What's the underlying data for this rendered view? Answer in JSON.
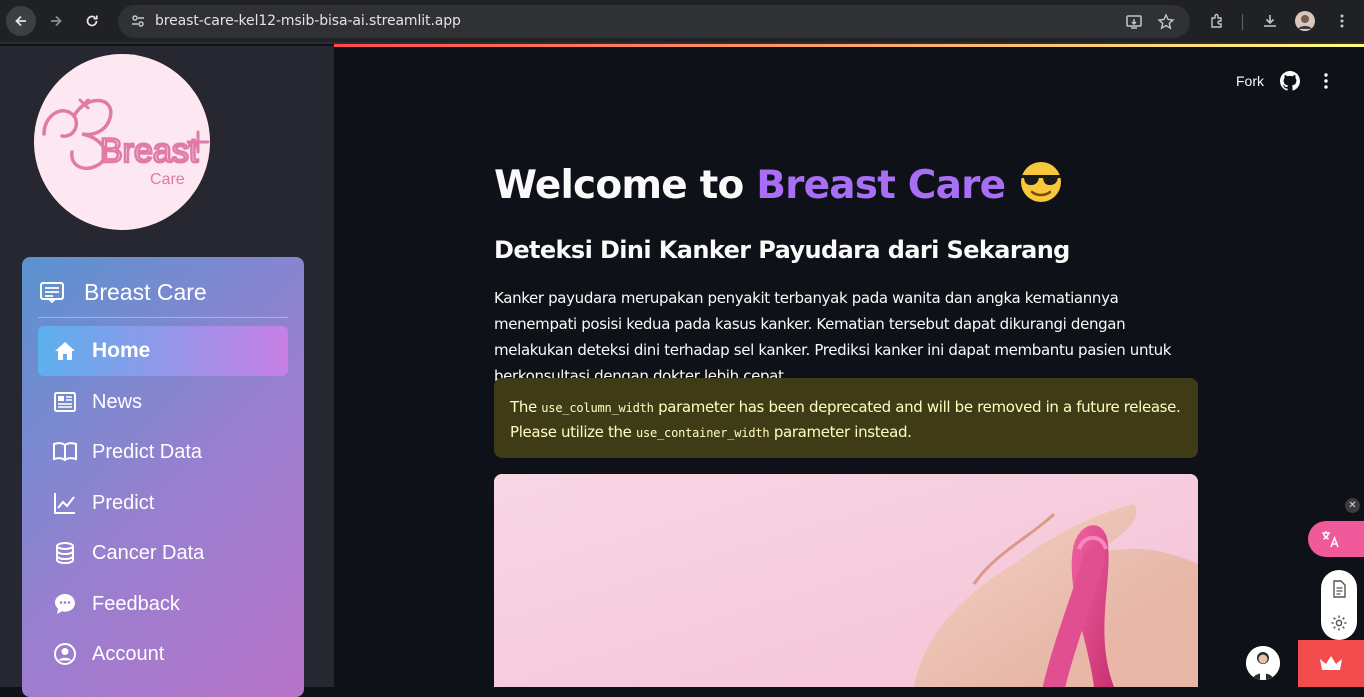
{
  "browser": {
    "url": "breast-care-kel12-msib-bisa-ai.streamlit.app"
  },
  "sidebar": {
    "logo_text": "Breast",
    "logo_subtext": "Care",
    "menu_title": "Breast Care",
    "items": [
      {
        "label": "Home",
        "icon": "house-icon",
        "active": true
      },
      {
        "label": "News",
        "icon": "newspaper-icon",
        "active": false
      },
      {
        "label": "Predict Data",
        "icon": "book-icon",
        "active": false
      },
      {
        "label": "Predict",
        "icon": "graph-up-icon",
        "active": false
      },
      {
        "label": "Cancer Data",
        "icon": "database-icon",
        "active": false
      },
      {
        "label": "Feedback",
        "icon": "chat-icon",
        "active": false
      },
      {
        "label": "Account",
        "icon": "person-circle-icon",
        "active": false
      }
    ]
  },
  "topbar": {
    "fork_label": "Fork"
  },
  "main": {
    "title_prefix": "Welcome to ",
    "title_accent": "Breast Care",
    "subtitle": "Deteksi Dini Kanker Payudara dari Sekarang",
    "paragraph": "Kanker payudara merupakan penyakit terbanyak pada wanita dan angka kematiannya menempati posisi kedua pada kasus kanker. Kematian tersebut dapat dikurangi dengan melakukan deteksi dini terhadap sel kanker. Prediksi kanker ini dapat membantu pasien untuk berkonsultasi dengan dokter lebih cepat.",
    "warning": {
      "t1": "The ",
      "code1": "use_column_width",
      "t2": " parameter has been deprecated and will be removed in a future release. Please utilize the ",
      "code2": "use_container_width",
      "t3": " parameter instead."
    }
  },
  "colors": {
    "accent": "#a86ef5",
    "warning_bg": "#3e3b16",
    "warning_text": "#ffffc2",
    "sidebar_bg": "#262730",
    "main_bg": "#0e1117"
  }
}
